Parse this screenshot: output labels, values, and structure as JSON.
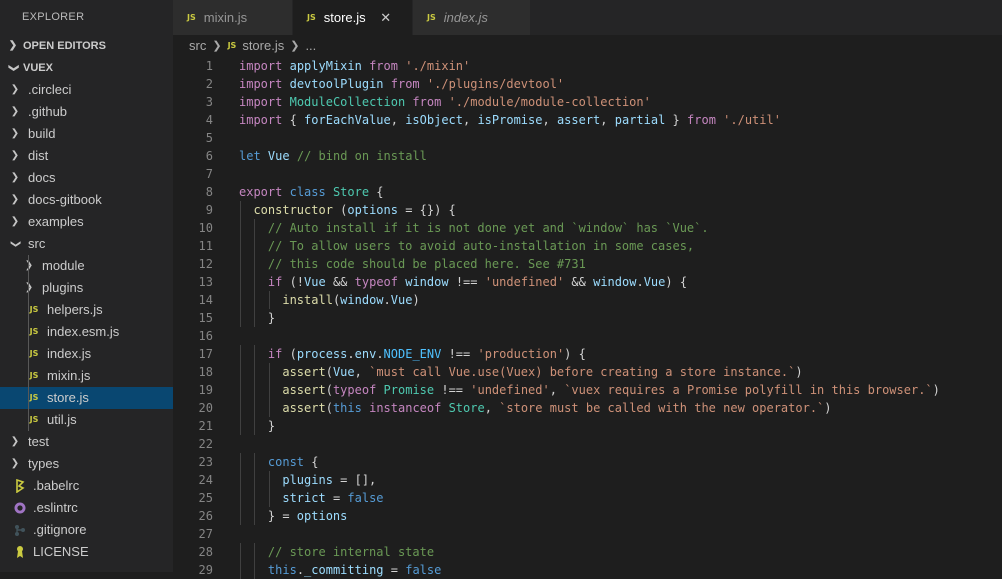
{
  "explorer": {
    "title": "EXPLORER",
    "open_editors": "OPEN EDITORS",
    "project": "VUEX",
    "items": [
      {
        "label": ".circleci",
        "kind": "folder"
      },
      {
        "label": ".github",
        "kind": "folder"
      },
      {
        "label": "build",
        "kind": "folder"
      },
      {
        "label": "dist",
        "kind": "folder"
      },
      {
        "label": "docs",
        "kind": "folder"
      },
      {
        "label": "docs-gitbook",
        "kind": "folder"
      },
      {
        "label": "examples",
        "kind": "folder"
      },
      {
        "label": "src",
        "kind": "folder-open"
      },
      {
        "label": "module",
        "kind": "folder"
      },
      {
        "label": "plugins",
        "kind": "folder"
      },
      {
        "label": "helpers.js",
        "kind": "js"
      },
      {
        "label": "index.esm.js",
        "kind": "js"
      },
      {
        "label": "index.js",
        "kind": "js"
      },
      {
        "label": "mixin.js",
        "kind": "js"
      },
      {
        "label": "store.js",
        "kind": "js"
      },
      {
        "label": "util.js",
        "kind": "js"
      },
      {
        "label": "test",
        "kind": "folder"
      },
      {
        "label": "types",
        "kind": "folder"
      },
      {
        "label": ".babelrc",
        "kind": "babel"
      },
      {
        "label": ".eslintrc",
        "kind": "eslint"
      },
      {
        "label": ".gitignore",
        "kind": "git"
      },
      {
        "label": "LICENSE",
        "kind": "license"
      }
    ],
    "js_badge": "JS"
  },
  "tabs": [
    {
      "label": "mixin.js"
    },
    {
      "label": "store.js",
      "close": "✕"
    },
    {
      "label": "index.js"
    }
  ],
  "breadcrumb": {
    "folder": "src",
    "file": "store.js",
    "more": "..."
  },
  "code_lines": [
    "import applyMixin from './mixin'",
    "import devtoolPlugin from './plugins/devtool'",
    "import ModuleCollection from './module/module-collection'",
    "import { forEachValue, isObject, isPromise, assert, partial } from './util'",
    "",
    "let Vue // bind on install",
    "",
    "export class Store {",
    "  constructor (options = {}) {",
    "    // Auto install if it is not done yet and `window` has `Vue`.",
    "    // To allow users to avoid auto-installation in some cases,",
    "    // this code should be placed here. See #731",
    "    if (!Vue && typeof window !== 'undefined' && window.Vue) {",
    "      install(window.Vue)",
    "    }",
    "",
    "    if (process.env.NODE_ENV !== 'production') {",
    "      assert(Vue, `must call Vue.use(Vuex) before creating a store instance.`)",
    "      assert(typeof Promise !== 'undefined', `vuex requires a Promise polyfill in this browser.`)",
    "      assert(this instanceof Store, `store must be called with the new operator.`)",
    "    }",
    "",
    "    const {",
    "      plugins = [],",
    "      strict = false",
    "    } = options",
    "",
    "    // store internal state",
    "    this._committing = false"
  ]
}
